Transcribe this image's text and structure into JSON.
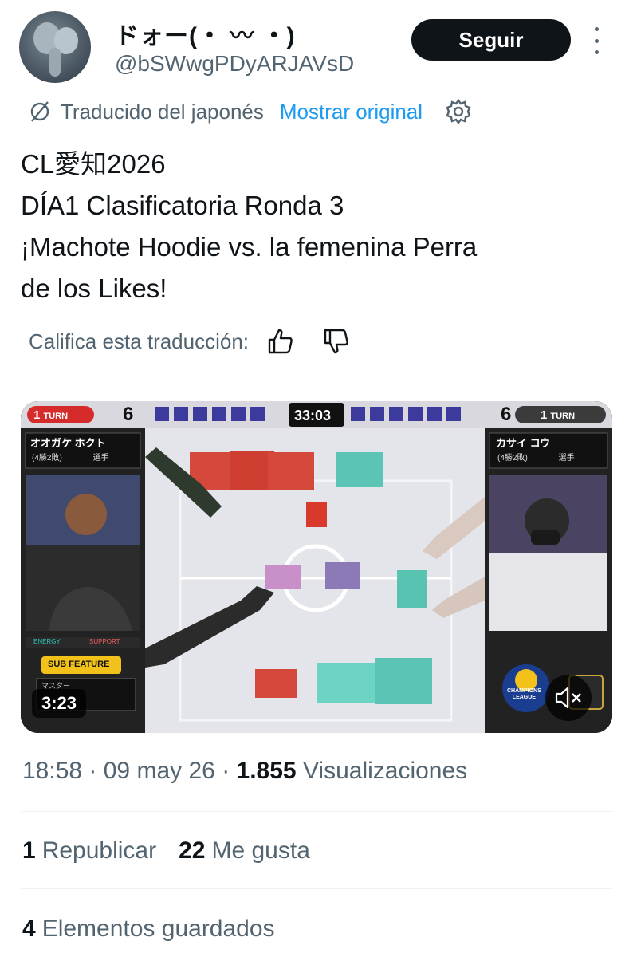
{
  "author": {
    "display_name": "ドォー(・ 〰 ・)",
    "handle": "@bSWwgPDyARJAVsD",
    "follow_label": "Seguir"
  },
  "translation": {
    "translated_from": "Traducido del japonés",
    "show_original": "Mostrar original",
    "rate_label": "Califica esta traducción:"
  },
  "tweet": {
    "lines": [
      "CL愛知2026",
      "DÍA1 Clasificatoria Ronda 3",
      "¡Machote Hoodie vs. la femenina Perra",
      "de los Likes!"
    ]
  },
  "video": {
    "duration": "3:23",
    "overlay": {
      "clock": "33:03",
      "left_turn": "1",
      "turn_label": "TURN",
      "left_prizes": "6",
      "right_prizes": "6",
      "right_turn": "1",
      "left_player": "オオガケ ホクト",
      "left_record": "(4勝2敗)",
      "right_player": "カサイ コウ",
      "right_record": "(4勝2敗)",
      "player_suffix": "選手",
      "sub_feature": "SUB FEATURE",
      "energy": "ENERGY",
      "support": "SUPPORT",
      "master": "マスター",
      "champions_line1": "CHAMPIONS",
      "champions_line2": "LEAGUE"
    }
  },
  "meta": {
    "time": "18:58",
    "date": "09 may 26",
    "views_count": "1.855",
    "views_label": "Visualizaciones"
  },
  "stats": {
    "reposts_count": "1",
    "reposts_label": "Republicar",
    "likes_count": "22",
    "likes_label": "Me gusta",
    "bookmarks_count": "4",
    "bookmarks_label": "Elementos guardados"
  },
  "colors": {
    "link": "#1d9bf0",
    "secondary_text": "#536471",
    "primary_text": "#0f1419",
    "divider": "#eff3f4"
  }
}
